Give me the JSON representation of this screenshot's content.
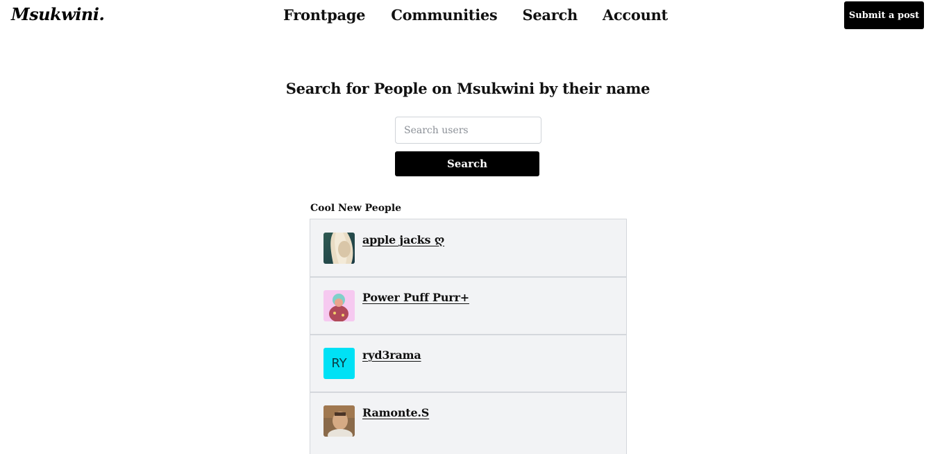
{
  "app": {
    "logo": "Msukwini."
  },
  "nav": {
    "items": [
      {
        "label": "Frontpage"
      },
      {
        "label": "Communities"
      },
      {
        "label": "Search"
      },
      {
        "label": "Account"
      }
    ],
    "submit_label": "Submit a post"
  },
  "search": {
    "heading": "Search for People on Msukwini by their name",
    "placeholder": "Search users",
    "value": "",
    "button_label": "Search"
  },
  "people": {
    "section_label": "Cool New People",
    "items": [
      {
        "name": "apple jacks ღ",
        "avatar": "photo-blonde-hair"
      },
      {
        "name": "Power Puff Purr+",
        "avatar": "illustration-pink"
      },
      {
        "name": "ryd3rama",
        "avatar_initials": "RY",
        "avatar_color": "#00e1f5"
      },
      {
        "name": "Ramonte.S",
        "avatar": "photo-man"
      }
    ]
  },
  "colors": {
    "accent": "#000000",
    "list_background": "#f2f3f5",
    "initials_avatar": "#00e1f5"
  }
}
